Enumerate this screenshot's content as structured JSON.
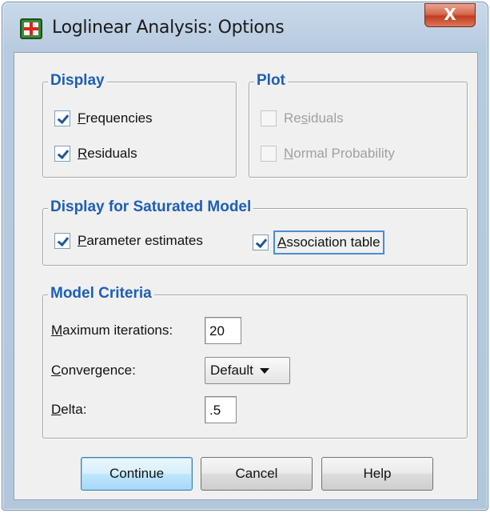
{
  "window": {
    "title": "Loglinear Analysis: Options",
    "close_glyph": "X"
  },
  "display": {
    "legend": "Display",
    "frequencies": {
      "label": "Frequencies",
      "checked": true
    },
    "residuals": {
      "label": "Residuals",
      "checked": true
    }
  },
  "plot": {
    "legend": "Plot",
    "residuals": {
      "label": "Residuals",
      "checked": false,
      "enabled": false
    },
    "normal_probability": {
      "label": "Normal Probability",
      "checked": false,
      "enabled": false
    }
  },
  "saturated": {
    "legend": "Display for Saturated Model",
    "parameter_estimates": {
      "label": "Parameter estimates",
      "checked": true
    },
    "association_table": {
      "label": "Association table",
      "checked": true,
      "focused": true
    }
  },
  "criteria": {
    "legend": "Model Criteria",
    "max_iterations_label": "Maximum iterations:",
    "max_iterations_value": "20",
    "convergence_label": "Convergence:",
    "convergence_value": "Default",
    "delta_label": "Delta:",
    "delta_value": ".5"
  },
  "buttons": {
    "continue": "Continue",
    "cancel": "Cancel",
    "help": "Help"
  },
  "colors": {
    "legend": "#1d5fb4",
    "checkmark": "#1e5799",
    "close": "#c23d1f"
  }
}
